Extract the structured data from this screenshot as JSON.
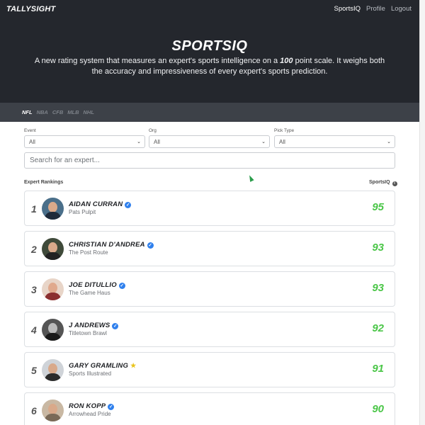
{
  "brand": "TALLYSIGHT",
  "nav": {
    "sportsiq": "SportsIQ",
    "profile": "Profile",
    "logout": "Logout"
  },
  "hero": {
    "title": "SPORTSIQ",
    "desc_before": "A new rating system that measures an expert's sports intelligence on a ",
    "desc_bold": "100",
    "desc_after": " point scale. It weighs both the accuracy and impressiveness of every expert's sports prediction."
  },
  "sports": [
    "NFL",
    "NBA",
    "CFB",
    "MLB",
    "NHL"
  ],
  "filters": {
    "event": {
      "label": "Event",
      "value": "All"
    },
    "org": {
      "label": "Org",
      "value": "All"
    },
    "pick_type": {
      "label": "Pick Type",
      "value": "All"
    }
  },
  "search": {
    "placeholder": "Search for an expert..."
  },
  "list": {
    "left_header": "Expert Rankings",
    "right_header": "SportsIQ",
    "info": "i"
  },
  "icons": {
    "verified": "verified-check-icon",
    "star": "star-icon",
    "info": "info-icon",
    "chevron": "chevron-down-icon"
  },
  "colors": {
    "header_bg": "#24272d",
    "score_green": "#4bc648",
    "verified_blue": "#2f80ed",
    "star_gold": "#e9c31a"
  },
  "rankings": [
    {
      "rank": "1",
      "name": "AIDAN CURRAN",
      "org": "Pats Pulpit",
      "score": "95",
      "badge": "verified"
    },
    {
      "rank": "2",
      "name": "CHRISTIAN D'ANDREA",
      "org": "The Post Route",
      "score": "93",
      "badge": "verified"
    },
    {
      "rank": "3",
      "name": "JOE DITULLIO",
      "org": "The Game Haus",
      "score": "93",
      "badge": "verified"
    },
    {
      "rank": "4",
      "name": "J ANDREWS",
      "org": "Titletown Brawl",
      "score": "92",
      "badge": "verified"
    },
    {
      "rank": "5",
      "name": "GARY GRAMLING",
      "org": "Sports Illustrated",
      "score": "91",
      "badge": "star"
    },
    {
      "rank": "6",
      "name": "RON KOPP",
      "org": "Arrowhead Pride",
      "score": "90",
      "badge": "verified"
    }
  ]
}
